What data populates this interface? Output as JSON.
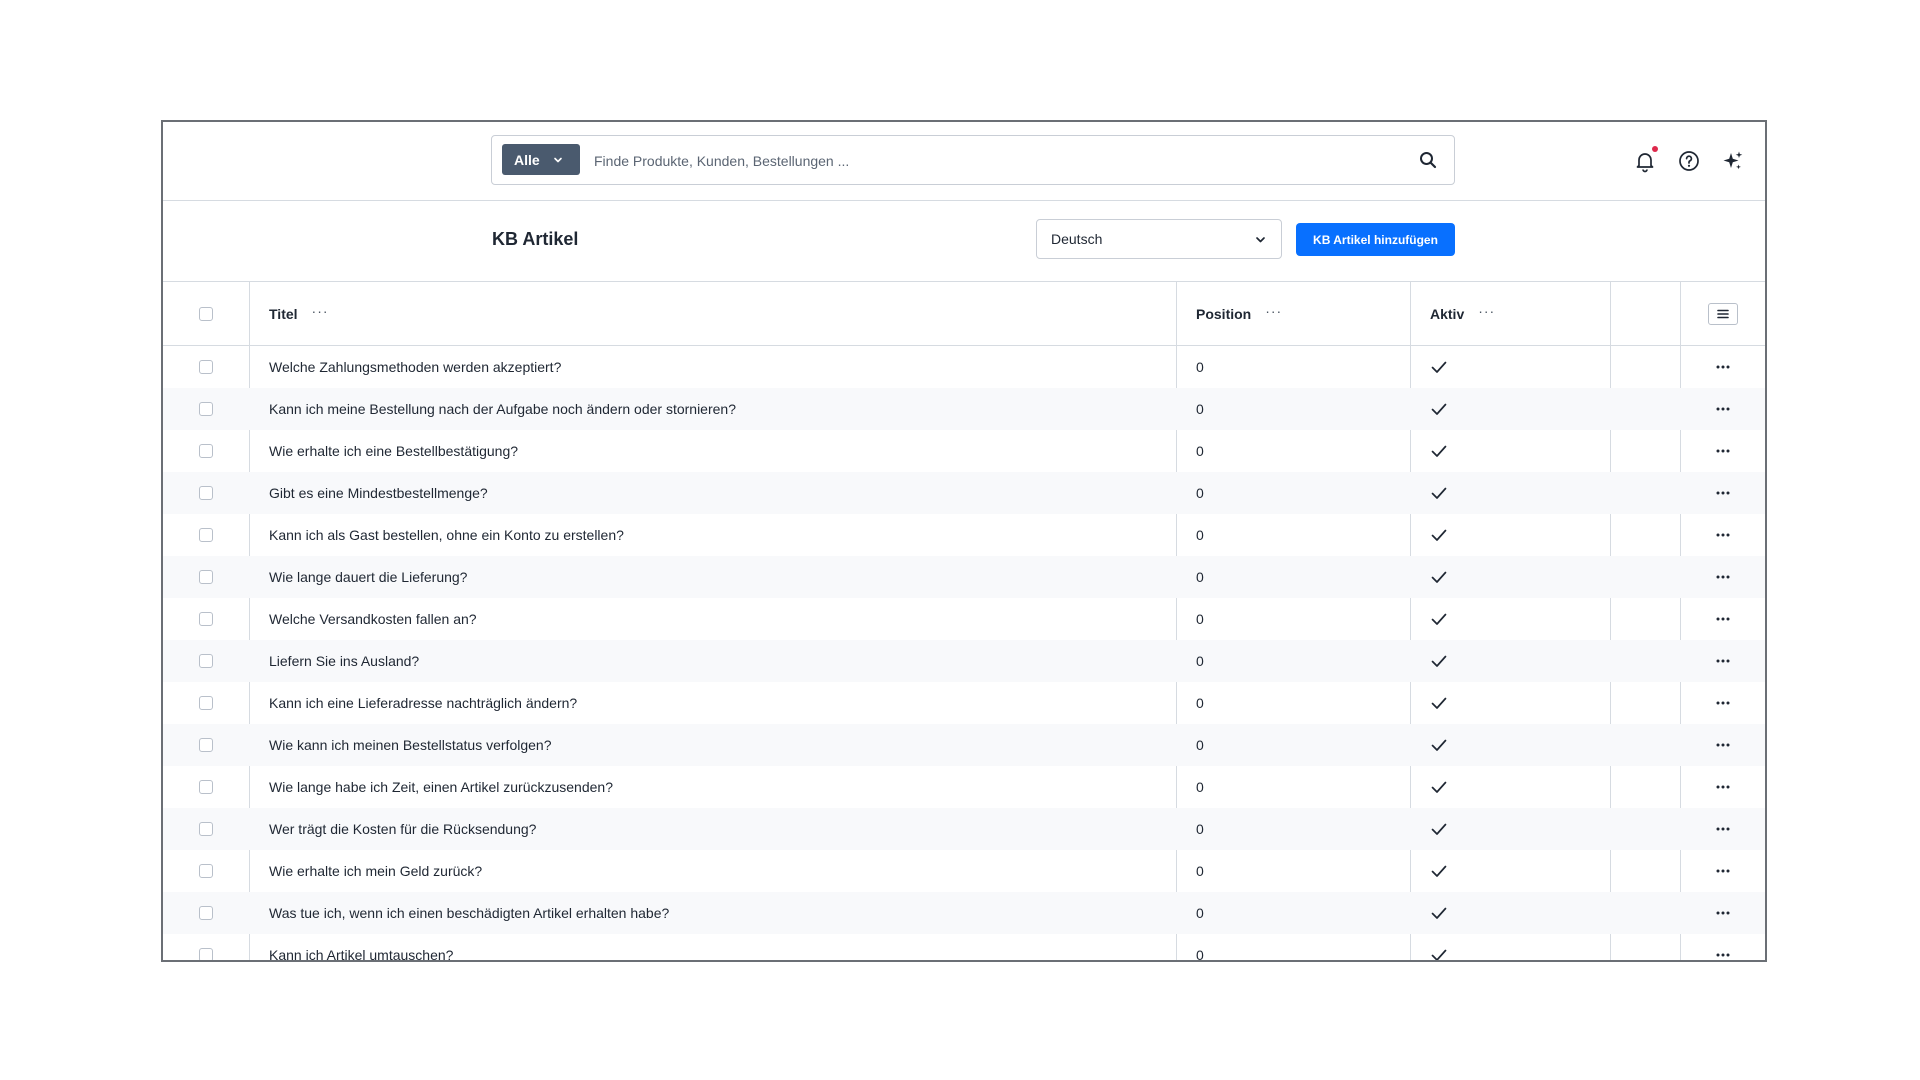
{
  "search": {
    "scope_label": "Alle",
    "placeholder": "Finde Produkte, Kunden, Bestellungen ..."
  },
  "header_icons": [
    "bell-icon",
    "help-circle-icon",
    "sparkles-icon"
  ],
  "page": {
    "title": "KB Artikel",
    "language": "Deutsch",
    "add_button": "KB Artikel hinzufügen"
  },
  "table": {
    "columns": {
      "title": "Titel",
      "position": "Position",
      "active": "Aktiv",
      "more": "···"
    },
    "rows": [
      {
        "title": "Welche Zahlungsmethoden werden akzeptiert?",
        "position": "0",
        "active": true
      },
      {
        "title": "Kann ich meine Bestellung nach der Aufgabe noch ändern oder stornieren?",
        "position": "0",
        "active": true
      },
      {
        "title": "Wie erhalte ich eine Bestellbestätigung?",
        "position": "0",
        "active": true
      },
      {
        "title": "Gibt es eine Mindestbestellmenge?",
        "position": "0",
        "active": true
      },
      {
        "title": "Kann ich als Gast bestellen, ohne ein Konto zu erstellen?",
        "position": "0",
        "active": true
      },
      {
        "title": "Wie lange dauert die Lieferung?",
        "position": "0",
        "active": true
      },
      {
        "title": "Welche Versandkosten fallen an?",
        "position": "0",
        "active": true
      },
      {
        "title": "Liefern Sie ins Ausland?",
        "position": "0",
        "active": true
      },
      {
        "title": "Kann ich eine Lieferadresse nachträglich ändern?",
        "position": "0",
        "active": true
      },
      {
        "title": "Wie kann ich meinen Bestellstatus verfolgen?",
        "position": "0",
        "active": true
      },
      {
        "title": "Wie lange habe ich Zeit, einen Artikel zurückzusenden?",
        "position": "0",
        "active": true
      },
      {
        "title": "Wer trägt die Kosten für die Rücksendung?",
        "position": "0",
        "active": true
      },
      {
        "title": "Wie erhalte ich mein Geld zurück?",
        "position": "0",
        "active": true
      },
      {
        "title": "Was tue ich, wenn ich einen beschädigten Artikel erhalten habe?",
        "position": "0",
        "active": true
      },
      {
        "title": "Kann ich Artikel umtauschen?",
        "position": "0",
        "active": true
      }
    ]
  },
  "colors": {
    "accent": "#0870ff",
    "scope_bg": "#4a5a6e",
    "notification_dot": "#de294c",
    "stripe": "#f8f9fb"
  }
}
